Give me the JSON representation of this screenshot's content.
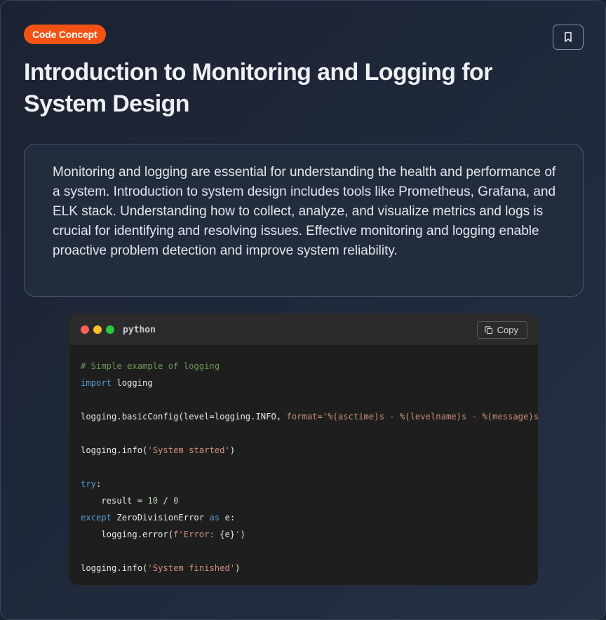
{
  "badge": {
    "label": "Code Concept"
  },
  "title": "Introduction to Monitoring and Logging for System Design",
  "description": "Monitoring and logging are essential for understanding the health and performance of a system. Introduction to system design includes tools like Prometheus, Grafana, and ELK stack. Understanding how to collect, analyze, and visualize metrics and logs is crucial for identifying and resolving issues. Effective monitoring and logging enable proactive problem detection and improve system reliability.",
  "bookmark": {
    "icon": "bookmark-icon"
  },
  "code": {
    "language": "python",
    "copy_label": "Copy",
    "window_dots": [
      "#ff5f56",
      "#ffbd2e",
      "#27c93f"
    ],
    "lines": [
      [
        {
          "t": "comment",
          "v": "# Simple example of logging"
        }
      ],
      [
        {
          "t": "keyword",
          "v": "import"
        },
        {
          "t": "plain",
          "v": " logging"
        }
      ],
      [],
      [
        {
          "t": "plain",
          "v": "logging.basicConfig(level=logging.INFO, "
        },
        {
          "t": "string",
          "v": "format='%(asctime)s - %(levelname)s - %(message)s'"
        },
        {
          "t": "plain",
          "v": ")"
        }
      ],
      [],
      [
        {
          "t": "plain",
          "v": "logging.info("
        },
        {
          "t": "string",
          "v": "'System started'"
        },
        {
          "t": "plain",
          "v": ")"
        }
      ],
      [],
      [
        {
          "t": "keyword",
          "v": "try"
        },
        {
          "t": "plain",
          "v": ":"
        }
      ],
      [
        {
          "t": "plain",
          "v": "    result = "
        },
        {
          "t": "number",
          "v": "10"
        },
        {
          "t": "plain",
          "v": " / "
        },
        {
          "t": "number",
          "v": "0"
        }
      ],
      [
        {
          "t": "keyword",
          "v": "except"
        },
        {
          "t": "plain",
          "v": " ZeroDivisionError "
        },
        {
          "t": "keyword",
          "v": "as"
        },
        {
          "t": "plain",
          "v": " e:"
        }
      ],
      [
        {
          "t": "plain",
          "v": "    logging.error("
        },
        {
          "t": "string",
          "v": "f'Error: "
        },
        {
          "t": "plain",
          "v": "{e}"
        },
        {
          "t": "string",
          "v": "'"
        },
        {
          "t": "plain",
          "v": ")"
        }
      ],
      [],
      [
        {
          "t": "plain",
          "v": "logging.info("
        },
        {
          "t": "string",
          "v": "'System finished'"
        },
        {
          "t": "plain",
          "v": ")"
        }
      ]
    ]
  },
  "colors": {
    "badge": "#f25314",
    "comment": "#6a9955",
    "keyword": "#569cd6",
    "string": "#ce9178",
    "number": "#b5cea8"
  }
}
